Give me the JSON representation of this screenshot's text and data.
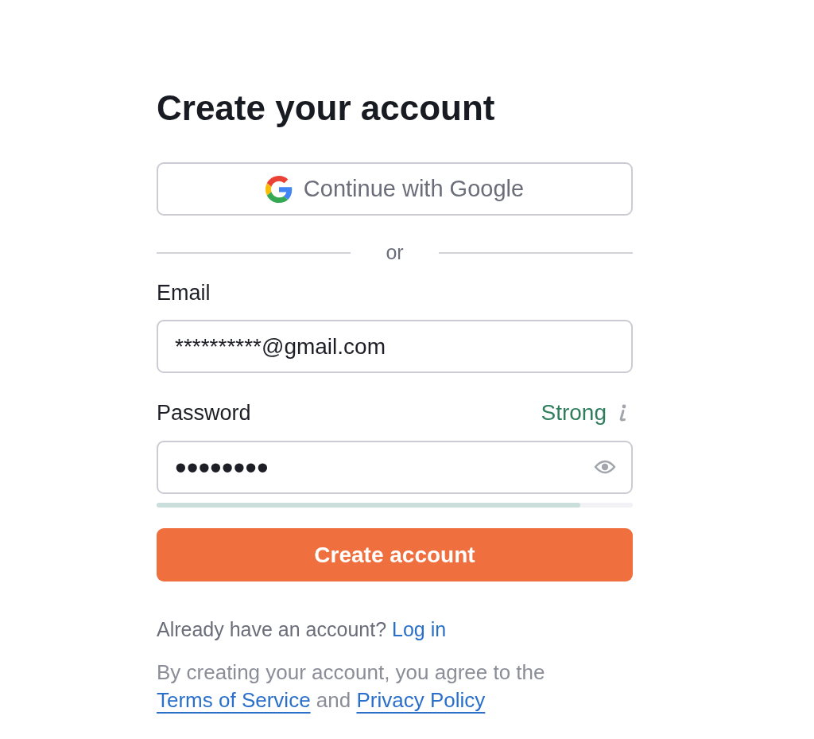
{
  "heading": "Create your account",
  "google_button": {
    "label": "Continue with Google"
  },
  "divider": {
    "label": "or"
  },
  "email": {
    "label": "Email",
    "value": "**********@gmail.com"
  },
  "password": {
    "label": "Password",
    "value": "••••••••",
    "strength": "Strong",
    "level": 0.89
  },
  "submit_button": {
    "label": "Create account"
  },
  "login_prompt": {
    "text": "Already have an account?",
    "link": "Log in"
  },
  "terms": {
    "parts": [
      {
        "kind": "text",
        "text": "By creating your account, you agree to the"
      },
      {
        "kind": "link",
        "text": "Terms of Service"
      },
      {
        "kind": "text",
        "text": "and"
      },
      {
        "kind": "link",
        "text": "Privacy Policy"
      }
    ]
  }
}
